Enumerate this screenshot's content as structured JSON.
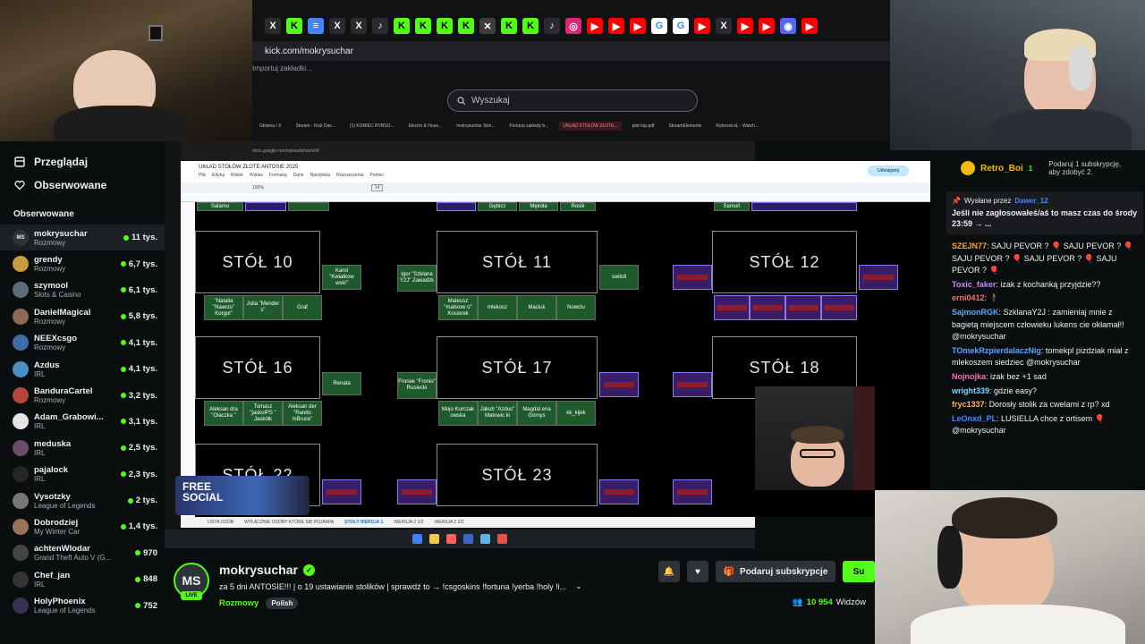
{
  "browser": {
    "url": "kick.com/mokrysuchar",
    "bookmark": "Importuj zakładki...",
    "search_placeholder": "Wyszukaj",
    "tabs": [
      "Główna / X",
      "Stream - Kick Das...",
      "(1) KONIEC RYBSO...",
      "Electro & Hous...",
      "mokrysuchar Stre...",
      "Fortuna zakłady b...",
      "UKŁAD STOŁÓW ZŁOTE...",
      "plot top.pdf",
      "StreamElements",
      "RybsonLoL - Watch..."
    ],
    "active_tab": "UKŁAD STOŁÓW ZŁOTE..."
  },
  "sidebar": {
    "nav": [
      {
        "icon": "browse-icon",
        "label": "Przeglądaj"
      },
      {
        "icon": "heart-icon",
        "label": "Obserwowane"
      }
    ],
    "section": "Obserwowane",
    "channels": [
      {
        "name": "mokrysuchar",
        "cat": "Rozmowy",
        "viewers": "11 tys.",
        "initials": "MS",
        "color": "#2e3338"
      },
      {
        "name": "grendy",
        "cat": "Rozmowy",
        "viewers": "6,7 tys.",
        "initials": "",
        "color": "#c89b3c"
      },
      {
        "name": "szymool",
        "cat": "Slots & Casino",
        "viewers": "6,1 tys.",
        "initials": "",
        "color": "#5a6e7a"
      },
      {
        "name": "DanielMagical",
        "cat": "Rozmowy",
        "viewers": "5,8 tys.",
        "initials": "",
        "color": "#8a6a55"
      },
      {
        "name": "NEEXcsgo",
        "cat": "Rozmowy",
        "viewers": "4,1 tys.",
        "initials": "",
        "color": "#3b6ea8"
      },
      {
        "name": "Azdus",
        "cat": "IRL",
        "viewers": "4,1 tys.",
        "initials": "",
        "color": "#4a8fc2"
      },
      {
        "name": "BanduraCartel",
        "cat": "Rozmowy",
        "viewers": "3,2 tys.",
        "initials": "",
        "color": "#b6453e"
      },
      {
        "name": "Adam_Grabowi...",
        "cat": "IRL",
        "viewers": "3,1 tys.",
        "initials": "",
        "color": "#e5e5e5"
      },
      {
        "name": "meduska",
        "cat": "IRL",
        "viewers": "2,5 tys.",
        "initials": "",
        "color": "#6b4c66"
      },
      {
        "name": "pajalock",
        "cat": "IRL",
        "viewers": "2,3 tys.",
        "initials": "",
        "color": "#262626"
      },
      {
        "name": "Vysotzky",
        "cat": "League of Legends",
        "viewers": "2 tys.",
        "initials": "",
        "color": "#777"
      },
      {
        "name": "Dobrodziej",
        "cat": "My Winter Car",
        "viewers": "1,4 tys.",
        "initials": "",
        "color": "#9a7258"
      },
      {
        "name": "achtenWlodar",
        "cat": "Grand Theft Auto V (G...",
        "viewers": "970",
        "initials": "",
        "color": "#444"
      },
      {
        "name": "Chef_jan",
        "cat": "IRL",
        "viewers": "848",
        "initials": "",
        "color": "#333"
      },
      {
        "name": "HolyPhoenix",
        "cat": "League of Legends",
        "viewers": "752",
        "initials": "",
        "color": "#3a2f55"
      }
    ]
  },
  "sheet": {
    "title": "UKŁAD STOŁÓW ZŁOTE ANTOSIE 2025",
    "menu": [
      "Plik",
      "Edytuj",
      "Widok",
      "Wstaw",
      "Formatuj",
      "Dane",
      "Narzędzia",
      "Rozszerzenia",
      "Pomoc"
    ],
    "share": "Udostępnij",
    "zoom": "100%",
    "font_size": "14",
    "tables": [
      "STÓŁ 10",
      "STÓŁ 11",
      "STÓŁ 12",
      "STÓŁ 16",
      "STÓŁ 17",
      "STÓŁ 18",
      "STÓŁ 22",
      "STÓŁ 23"
    ],
    "top_seats": [
      "Salamo",
      "Gębicz",
      "Mękoła",
      "Rosik",
      "Samoń"
    ],
    "seats": {
      "s10_right": "Karol \"Kwiatkow wski\"",
      "s10_b1": "\"Natalia \"Nawcio\" Korgol\"",
      "s10_b2": "Julia \"Mender s\"",
      "s10_b3": "Graf",
      "s11_left": "Igor \"Szklana Y2J\" Zawadzk",
      "s11_b1": "Mateusz \"matixow o\" Kosiorek",
      "s11_b2": "mlekosz",
      "s11_b3": "Maciuk",
      "s11_b4": "Nowclu",
      "s11_right": "switoll",
      "s16_right": "Renata",
      "s16_b1": "Aleksan dra \"Olaczka \"",
      "s16_b2": "Tomasz \"jaskolPS \" Jaskółk",
      "s16_b3": "Aleksan der \"Rando mBruce\"",
      "s17_left": "Fronek \"Fronio\" Rusiecki",
      "s17_b1": "Mojo Korczak owska",
      "s17_b2": "Jakub \"Azdus\" Matowic ki",
      "s17_b3": "Magdal ena Górnys",
      "s17_b4": "kk_kijek"
    },
    "tabs": [
      "LISTA OSÓB",
      "WYŁĄCZNIE OSOBY KTÓRE SIĘ POJAWIĄ",
      "STOŁY WERSJA 1",
      "WERSJA 2 1/2",
      "WERSJA 2 2/2"
    ],
    "active_tab": "STOŁY WERSJA 1"
  },
  "overlay_banner": "FREE SOCIAL",
  "chat": {
    "top_user": "Retro_Boi",
    "top_badge": "1",
    "sub_prompt": "Podaruj 1 subskrypcję, aby zdobyć 2.",
    "pinned_by": "Wysłane przez",
    "pinned_user": "Dawer_12",
    "pinned_text": "Jeśli nie zagłosowałeś/aś to masz czas do środy 23:59 → ...",
    "messages": [
      {
        "user": "SZEJN77",
        "color": "#ff9f40",
        "text": "SAJU PEVOR ? 🎈 SAJU PEVOR ? 🎈 SAJU PEVOR ? 🎈 SAJU PEVOR ? 🎈 SAJU PEVOR ? 🎈"
      },
      {
        "user": "Toxic_faker",
        "color": "#c58bff",
        "text": "izak z kochanką przyjdzie??"
      },
      {
        "user": "erni0412",
        "color": "#ff6b6b",
        "text": "🕴"
      },
      {
        "user": "SajmonRGK",
        "color": "#56a8ff",
        "text": "SzklanaY2J : zamieniaj mnie z bagietą miejscem człowieku lukens cie okłamał!! @mokrysuchar"
      },
      {
        "user": "TOmekRzpierdalaczNig",
        "color": "#56a8ff",
        "text": "tomekpl pizdziak miał z mlekoszem siedziec @mokrysuchar"
      },
      {
        "user": "Nojnojka",
        "color": "#ff6bb3",
        "text": "izak bez +1 sad"
      },
      {
        "user": "wright339",
        "color": "#7bd3ff",
        "text": "gdzie easy?"
      },
      {
        "user": "fryc1337",
        "color": "#ffb347",
        "text": "Dorosły stolik za cwelami z rp? xd"
      },
      {
        "user": "LeOnxd_PL",
        "color": "#3f8cff",
        "text": "LUSIELLA chce z ortisem 🎈 @mokrysuchar"
      }
    ]
  },
  "stream": {
    "avatar": "MS",
    "live": "LIVE",
    "name": "mokrysuchar",
    "title": "za 5 dni ANTOSIE!!! | o 19 ustawianie stolików | sprawdź to → !csgoskins !fortuna !yerba !holy !i...",
    "category": "Rozmowy",
    "tag": "Polish",
    "gift_label": "Podaruj subskrypcje",
    "sub_label": "Su",
    "viewers": "10 954",
    "viewers_label": "Widzów"
  }
}
